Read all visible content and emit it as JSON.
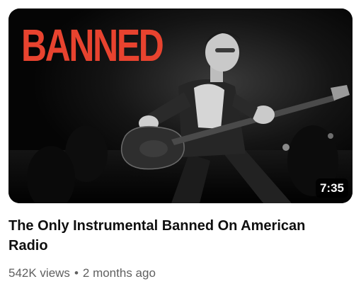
{
  "video": {
    "thumbnail_text": "BANNED",
    "duration": "7:35",
    "title": "The Only Instrumental Banned On American Radio",
    "views": "542K views",
    "separator": "•",
    "age": "2 months ago"
  },
  "colors": {
    "banner_red": "#e8432f",
    "title_text": "#0f0f0f",
    "meta_text": "#606060",
    "duration_bg": "#000000"
  }
}
